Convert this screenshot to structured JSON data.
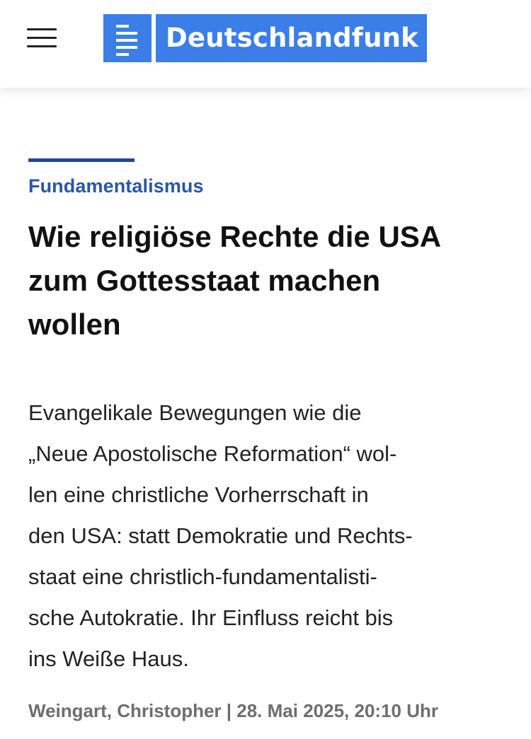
{
  "header": {
    "menu_icon": "hamburger-menu-icon",
    "brand": "Deutschlandfunk",
    "brand_color": "#3b7ee8"
  },
  "article": {
    "rubric": "Fundamentalismus",
    "rubric_color": "#2a56a8",
    "headline_lines": [
      "Wie religiöse Rechte die USA",
      "zum Gottesstaat machen",
      "wollen"
    ],
    "teaser_lines": [
      "Evangelikale Bewegungen wie die",
      "„Neue Apostolische Reformation“ wol-",
      "len eine christliche Vorherrschaft in",
      "den USA: statt Demokratie und Rechts-",
      "staat eine christlich-fundamentalisti-",
      "sche Autokratie. Ihr Einfluss reicht bis",
      "ins Weiße Haus."
    ],
    "byline": "Weingart, Christopher | 28. Mai 2025, 20:10 Uhr"
  }
}
